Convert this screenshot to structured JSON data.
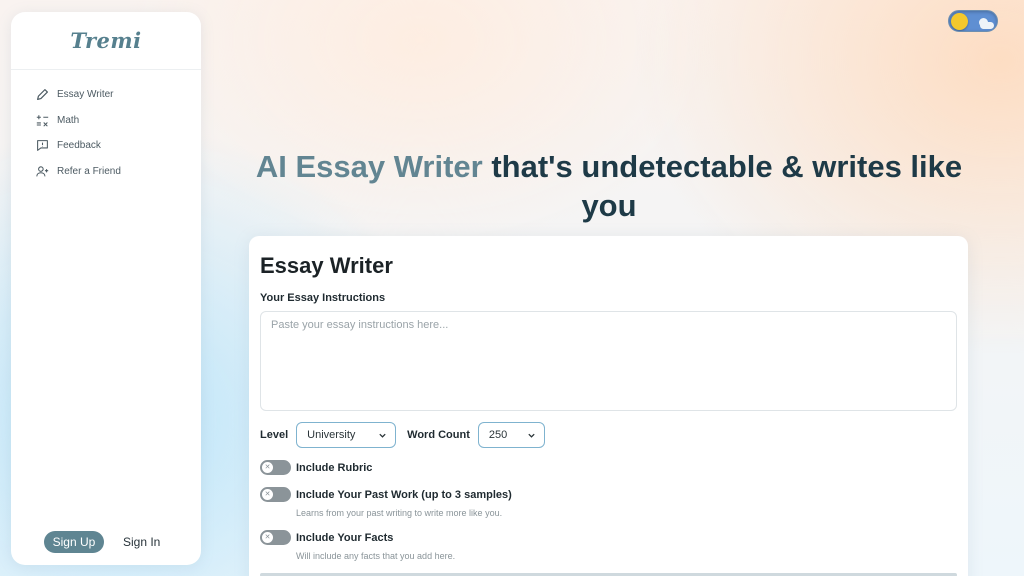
{
  "brand": {
    "name": "Tremi"
  },
  "sidebar": {
    "items": [
      {
        "label": "Essay Writer",
        "icon": "pencil-icon"
      },
      {
        "label": "Math",
        "icon": "calculator-icon"
      },
      {
        "label": "Feedback",
        "icon": "feedback-icon"
      },
      {
        "label": "Refer a Friend",
        "icon": "add-user-icon"
      }
    ],
    "sign_up": "Sign Up",
    "sign_in": "Sign In"
  },
  "theme_toggle": {
    "mode": "light",
    "icon": "sun-icon"
  },
  "hero": {
    "accent": "AI Essay Writer",
    "rest": " that's undetectable & writes like you"
  },
  "form": {
    "title": "Essay Writer",
    "instructions_label": "Your Essay Instructions",
    "instructions_placeholder": "Paste your essay instructions here...",
    "instructions_value": "",
    "level_label": "Level",
    "level_value": "University",
    "word_count_label": "Word Count",
    "word_count_value": "250",
    "toggles": [
      {
        "label": "Include Rubric",
        "on": false,
        "hint": ""
      },
      {
        "label": "Include Your Past Work (up to 3 samples)",
        "on": false,
        "hint": "Learns from your past writing to write more like you."
      },
      {
        "label": "Include Your Facts",
        "on": false,
        "hint": "Will include any facts that you add here."
      }
    ]
  },
  "colors": {
    "accent": "#628592",
    "button": "#5f8592",
    "heading": "#1e3a47",
    "select_border": "#7fb3cf"
  }
}
